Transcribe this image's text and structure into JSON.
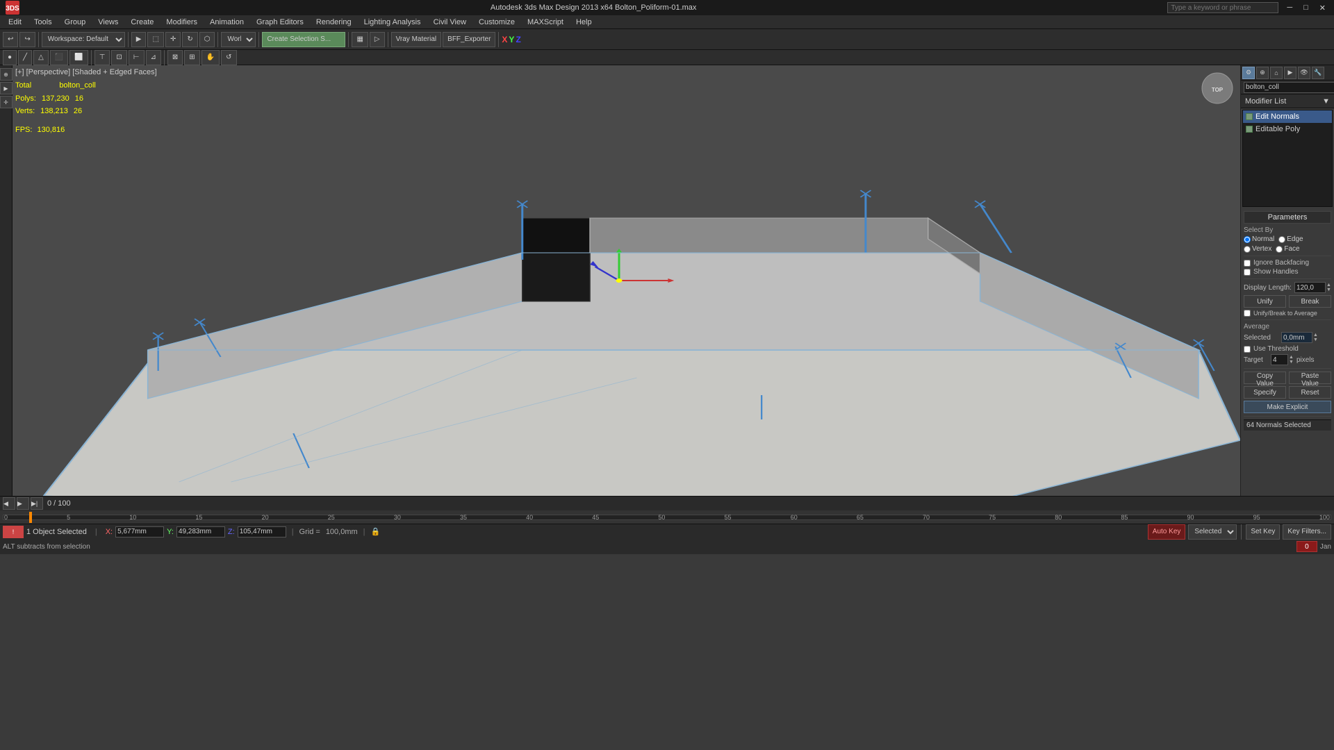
{
  "titlebar": {
    "left": "3DS",
    "center": "Autodesk 3ds Max Design 2013 x64    Bolton_Poliform-01.max",
    "search_placeholder": "Type a keyword or phrase"
  },
  "menubar": {
    "items": [
      "Edit",
      "Tools",
      "Group",
      "Views",
      "Create",
      "Modifiers",
      "Animation",
      "Graph Editors",
      "Rendering",
      "Lighting Analysis",
      "Civil View",
      "Customize",
      "MAXScript",
      "Help"
    ]
  },
  "toolbar": {
    "workspace_label": "Workspace: Default",
    "create_selection_label": "Create Selection S...",
    "vray_material_label": "Vray Material",
    "bff_exporter_label": "BFF_Exporter",
    "coord_system": "World"
  },
  "viewport": {
    "label": "[+] [Perspective] [Shaded + Edged Faces]",
    "stats": {
      "total_label": "Total",
      "object_label": "bolton_coll",
      "polys_label": "Polys:",
      "polys_total": "137,230",
      "polys_obj": "16",
      "verts_label": "Verts:",
      "verts_total": "138,213",
      "verts_obj": "26",
      "fps_label": "FPS:",
      "fps_value": "130,816"
    }
  },
  "right_panel": {
    "object_name": "bolton_coll",
    "modifier_list_label": "Modifier List",
    "modifiers": [
      {
        "name": "Edit Normals",
        "active": true,
        "visible": true
      },
      {
        "name": "Editable Poly",
        "active": false,
        "visible": true
      }
    ],
    "icons": [
      "pin",
      "shape",
      "wire",
      "camera",
      "file"
    ]
  },
  "parameters": {
    "title": "Parameters",
    "select_by_label": "Select By",
    "normal_label": "Normal",
    "edge_label": "Edge",
    "vertex_label": "Vertex",
    "face_label": "Face",
    "ignore_backfacing_label": "Ignore Backfacing",
    "show_handles_label": "Show Handles",
    "display_length_label": "Display Length:",
    "display_length_value": "120,0",
    "unify_label": "Unify",
    "break_label": "Break",
    "unify_break_avg_label": "Unify/Break to Average",
    "average_label": "Average",
    "selected_label": "Selected",
    "selected_value": "0,0mm",
    "use_threshold_label": "Use Threshold",
    "target_label": "Target",
    "target_value": "4",
    "target_unit": "pixels",
    "copy_value_label": "Copy Value",
    "paste_value_label": "Paste Value",
    "specify_label": "Specify",
    "reset_label": "Reset",
    "make_explicit_label": "Make Explicit",
    "normals_selected_label": "64 Normals Selected"
  },
  "timeline": {
    "current_frame": "0",
    "total_frames": "100",
    "frame_display": "0 / 100",
    "ruler_marks": [
      "0",
      "5",
      "10",
      "15",
      "20",
      "25",
      "30",
      "35",
      "40",
      "45",
      "50",
      "55",
      "60",
      "65",
      "70",
      "75",
      "80",
      "85",
      "90",
      "95",
      "100"
    ]
  },
  "status_bar": {
    "objects_selected": "1 Object Selected",
    "hint": "ALT subtracts from selection",
    "x_label": "X:",
    "x_value": "5,677mm",
    "y_label": "Y:",
    "y_value": "49,283mm",
    "z_label": "Z:",
    "z_value": "105,47mm",
    "grid_label": "Grid =",
    "grid_value": "100,0mm",
    "auto_key_label": "Auto Key",
    "selected_label": "Selected",
    "set_key_label": "Set Key",
    "key_filters_label": "Key Filters...",
    "jan_label": "Jan",
    "time_value": "0"
  }
}
